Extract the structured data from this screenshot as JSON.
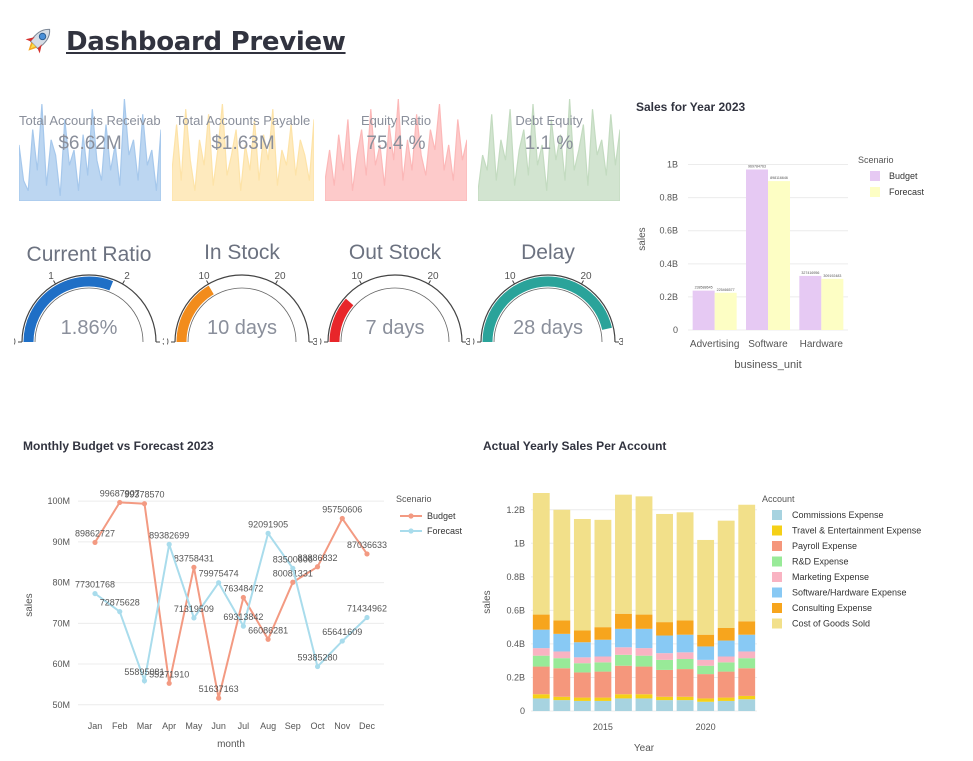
{
  "page": {
    "title": "Dashboard Preview",
    "icon": "rocket-icon"
  },
  "kpis": [
    {
      "label": "Total Accounts Receivable",
      "value": "$6.62M",
      "color": "#a6c8ec",
      "spark": [
        0.55,
        0.2,
        0.1,
        0.7,
        0.3,
        0.95,
        0.15,
        0.6,
        0.45,
        0.05,
        0.8,
        0.35,
        0.5,
        0.1,
        0.65,
        0.25,
        0.9,
        0.4,
        0.2,
        0.75,
        0.3,
        0.55,
        0.15,
        1.0,
        0.45,
        0.6,
        0.2,
        0.85,
        0.35,
        0.5,
        0.1,
        0.7
      ]
    },
    {
      "label": "Total Accounts Payable",
      "value": "$1.63M",
      "color": "#fde3a8",
      "spark": [
        0.3,
        0.75,
        0.2,
        0.9,
        0.4,
        0.1,
        0.6,
        0.35,
        0.85,
        0.15,
        0.5,
        0.95,
        0.25,
        0.45,
        0.7,
        0.1,
        0.55,
        0.3,
        0.8,
        0.2,
        0.65,
        0.4,
        0.9,
        0.15,
        0.5,
        0.35,
        0.75,
        0.25,
        0.6,
        0.45,
        0.2,
        0.8
      ]
    },
    {
      "label": "Equity Ratio",
      "value": "75.4 %",
      "color": "#fcb8b8",
      "spark": [
        0.2,
        0.5,
        0.15,
        0.65,
        0.3,
        0.8,
        0.1,
        0.45,
        0.7,
        0.25,
        0.9,
        0.35,
        0.55,
        0.15,
        0.75,
        0.4,
        1.0,
        0.2,
        0.6,
        0.3,
        0.85,
        0.45,
        0.25,
        0.7,
        0.5,
        0.95,
        0.3,
        0.55,
        0.2,
        0.8,
        0.4,
        0.6
      ]
    },
    {
      "label": "Debt Equity",
      "value": "1.1 %",
      "color": "#c3dbc0",
      "spark": [
        0.1,
        0.45,
        0.3,
        0.85,
        0.2,
        0.6,
        0.4,
        0.9,
        0.15,
        0.5,
        0.7,
        0.25,
        0.95,
        0.35,
        0.55,
        0.1,
        0.8,
        0.4,
        0.65,
        0.2,
        1.0,
        0.3,
        0.5,
        0.75,
        0.15,
        0.9,
        0.45,
        0.6,
        0.25,
        0.85,
        0.35,
        0.7
      ]
    }
  ],
  "gauges": [
    {
      "title": "Current Ratio",
      "value": "1.86%",
      "level": 0.62,
      "color": "#1f6fc6",
      "ticks": [
        "0",
        "1",
        "2",
        "3"
      ]
    },
    {
      "title": "In Stock",
      "value": "10 days",
      "level": 0.33,
      "color": "#f28c1c",
      "ticks": [
        "0",
        "10",
        "20",
        "30"
      ]
    },
    {
      "title": "Out Stock",
      "value": "7 days",
      "level": 0.23,
      "color": "#e8262a",
      "ticks": [
        "0",
        "10",
        "20",
        "30"
      ]
    },
    {
      "title": "Delay",
      "value": "28 days",
      "level": 0.93,
      "color": "#2aa39a",
      "ticks": [
        "0",
        "10",
        "20",
        "30"
      ]
    }
  ],
  "sales2023": {
    "title": "Sales for Year 2023",
    "chart_data": {
      "type": "bar",
      "categories": [
        "Advertising",
        "Software",
        "Hardware"
      ],
      "xlabel": "business_unit",
      "ylabel": "sales",
      "ylim": [
        0,
        1.1
      ],
      "y_ticks": [
        "0",
        "0.2B",
        "0.4B",
        "0.6B",
        "0.8B",
        "1B"
      ],
      "legend_title": "Scenario",
      "series": [
        {
          "name": "Budget",
          "color": "#e6c9f3",
          "values": [
            0.238,
            0.97,
            0.327
          ],
          "labels": [
            "238588645",
            "969784763",
            "327416956"
          ]
        },
        {
          "name": "Forecast",
          "color": "#fdfec4",
          "values": [
            0.225,
            0.9,
            0.309
          ],
          "labels": [
            "225466577",
            "898116646",
            "309192483"
          ]
        }
      ]
    }
  },
  "monthly": {
    "title": "Monthly Budget vs Forecast 2023",
    "chart_data": {
      "type": "line",
      "categories": [
        "Jan",
        "Feb",
        "Mar",
        "Apr",
        "May",
        "Jun",
        "Jul",
        "Aug",
        "Sep",
        "Oct",
        "Nov",
        "Dec"
      ],
      "xlabel": "month",
      "ylabel": "sales",
      "ylim": [
        47,
        102
      ],
      "y_ticks": [
        "50M",
        "60M",
        "70M",
        "80M",
        "90M",
        "100M"
      ],
      "legend_title": "Scenario",
      "series": [
        {
          "name": "Budget",
          "color": "#f39a82",
          "values": [
            89862727,
            99687907,
            99378570,
            55271910,
            83758431,
            51637163,
            76348472,
            66086281,
            80081331,
            83886832,
            95750606,
            87036633
          ]
        },
        {
          "name": "Forecast",
          "color": "#a9dcec",
          "values": [
            77301768,
            72875628,
            55895081,
            89382699,
            71319509,
            79975474,
            69313842,
            92091905,
            83500606,
            59385280,
            65641609,
            71434962
          ]
        }
      ]
    }
  },
  "yearly": {
    "title": "Actual Yearly Sales Per Account",
    "chart_data": {
      "type": "bar",
      "stacked": true,
      "x": [
        2012,
        2013,
        2014,
        2015,
        2016,
        2017,
        2018,
        2019,
        2020,
        2021,
        2022
      ],
      "x_ticks": [
        "2015",
        "2020"
      ],
      "xlabel": "Year",
      "ylabel": "sales",
      "ylim": [
        0,
        1.3
      ],
      "y_ticks": [
        "0",
        "0.2B",
        "0.4B",
        "0.6B",
        "0.8B",
        "1B",
        "1.2B"
      ],
      "legend_title": "Account",
      "series": [
        {
          "name": "Commissions Expense",
          "color": "#a7d3e0",
          "values": [
            0.075,
            0.065,
            0.06,
            0.06,
            0.075,
            0.075,
            0.065,
            0.065,
            0.055,
            0.06,
            0.07
          ]
        },
        {
          "name": "Travel & Entertainment Expense",
          "color": "#f5d017",
          "values": [
            0.025,
            0.02,
            0.02,
            0.02,
            0.025,
            0.025,
            0.02,
            0.02,
            0.02,
            0.02,
            0.02
          ]
        },
        {
          "name": "Payroll Expense",
          "color": "#f5977c",
          "values": [
            0.165,
            0.17,
            0.15,
            0.155,
            0.17,
            0.165,
            0.16,
            0.165,
            0.145,
            0.155,
            0.165
          ]
        },
        {
          "name": "R&D Expense",
          "color": "#98ea98",
          "values": [
            0.065,
            0.06,
            0.055,
            0.055,
            0.065,
            0.065,
            0.06,
            0.06,
            0.05,
            0.055,
            0.06
          ]
        },
        {
          "name": "Marketing Expense",
          "color": "#f9b3c2",
          "values": [
            0.045,
            0.04,
            0.035,
            0.035,
            0.045,
            0.045,
            0.04,
            0.04,
            0.035,
            0.035,
            0.04
          ]
        },
        {
          "name": "Software/Hardware Expense",
          "color": "#88c9f4",
          "values": [
            0.11,
            0.105,
            0.09,
            0.1,
            0.11,
            0.115,
            0.105,
            0.105,
            0.08,
            0.095,
            0.1
          ]
        },
        {
          "name": "Consulting Expense",
          "color": "#f7a51d",
          "values": [
            0.09,
            0.08,
            0.07,
            0.075,
            0.09,
            0.085,
            0.08,
            0.085,
            0.07,
            0.075,
            0.08
          ]
        },
        {
          "name": "Cost of Goods Sold",
          "color": "#f2e08a",
          "values": [
            0.725,
            0.66,
            0.665,
            0.64,
            0.71,
            0.705,
            0.645,
            0.645,
            0.565,
            0.64,
            0.695
          ]
        }
      ]
    }
  }
}
